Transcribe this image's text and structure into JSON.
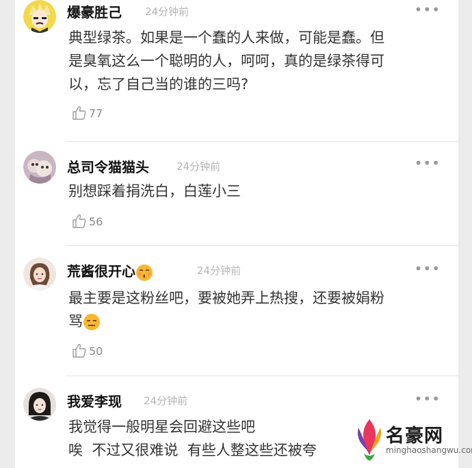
{
  "comments": [
    {
      "username": "爆豪胜己",
      "time": "24分钟前",
      "more": "•••",
      "lines": [
        "典型绿茶。如果是一个蠢的人来做，可能是蠢。但",
        "是臭氧这么一个聪明的人，呵呵，真的是绿茶得可",
        "以，忘了自己当的谁的三吗?"
      ],
      "likes": "77"
    },
    {
      "username": "总司令猫猫头",
      "time": "24分钟前",
      "more": "•••",
      "lines": [
        "别想踩着捐洗白，白莲小三"
      ],
      "likes": "56"
    },
    {
      "username": "荒酱很开心",
      "username_emoji": "kiss-face",
      "time": "24分钟前",
      "more": "•••",
      "lines": [
        "最主要是这粉丝吧，要被她弄上热搜，还要被娟粉",
        "骂"
      ],
      "line2_emoji": "expressionless-face",
      "likes": "50"
    },
    {
      "username": "我爱李现",
      "time": "24分钟前",
      "more": "•••",
      "lines": [
        "我觉得一般明星会回避这些吧",
        "唉  不过又很难说  有些人整这些还被夸"
      ]
    }
  ],
  "watermark": {
    "title": "名豪网",
    "url": "minghaoshangwu.com"
  },
  "colors": {
    "text": "#333333",
    "username": "#111111",
    "meta": "#b4b4b4",
    "frame": "#ececec"
  }
}
